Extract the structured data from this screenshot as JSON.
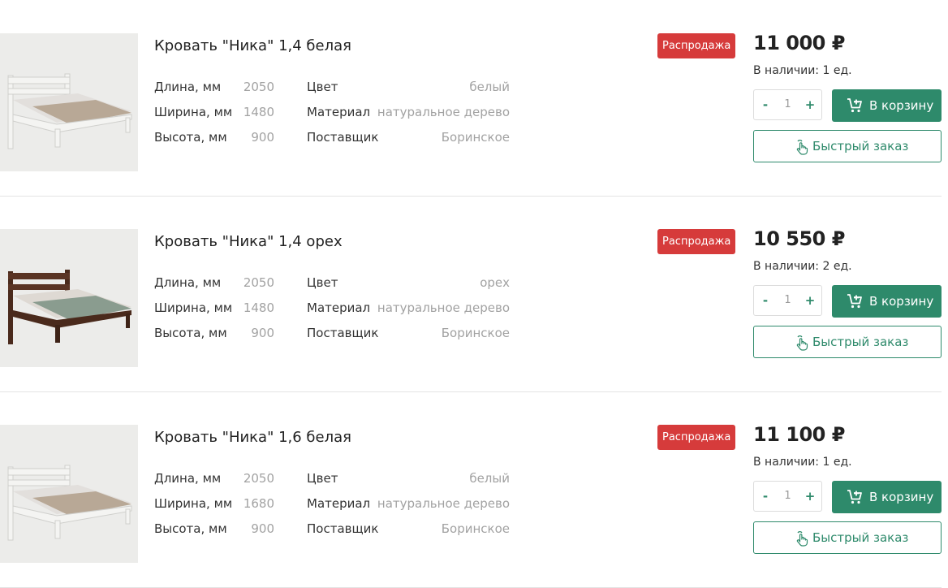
{
  "labels": {
    "length": "Длина, мм",
    "width": "Ширина, мм",
    "height": "Высота, мм",
    "color": "Цвет",
    "material": "Материал",
    "supplier": "Поставщик",
    "add_to_cart": "В корзину",
    "quick_order": "Быстрый заказ",
    "qty_minus": "-",
    "qty_plus": "+"
  },
  "products": [
    {
      "title": "Кровать \"Ника\" 1,4 белая",
      "badge": "Распродажа",
      "price": "11 000 ₽",
      "stock": "В наличии: 1 ед.",
      "length": "2050",
      "width": "1480",
      "height": "900",
      "color": "белый",
      "material": "натуральное дерево",
      "supplier": "Боринское",
      "qty": "1",
      "frame_color": "#f4f4f2"
    },
    {
      "title": "Кровать \"Ника\" 1,4 орех",
      "badge": "Распродажа",
      "price": "10 550 ₽",
      "stock": "В наличии: 2 ед.",
      "length": "2050",
      "width": "1480",
      "height": "900",
      "color": "орех",
      "material": "натуральное дерево",
      "supplier": "Боринское",
      "qty": "1",
      "frame_color": "#4a2a1c"
    },
    {
      "title": "Кровать \"Ника\" 1,6 белая",
      "badge": "Распродажа",
      "price": "11 100 ₽",
      "stock": "В наличии: 1 ед.",
      "length": "2050",
      "width": "1680",
      "height": "900",
      "color": "белый",
      "material": "натуральное дерево",
      "supplier": "Боринское",
      "qty": "1",
      "frame_color": "#f4f4f2"
    }
  ]
}
